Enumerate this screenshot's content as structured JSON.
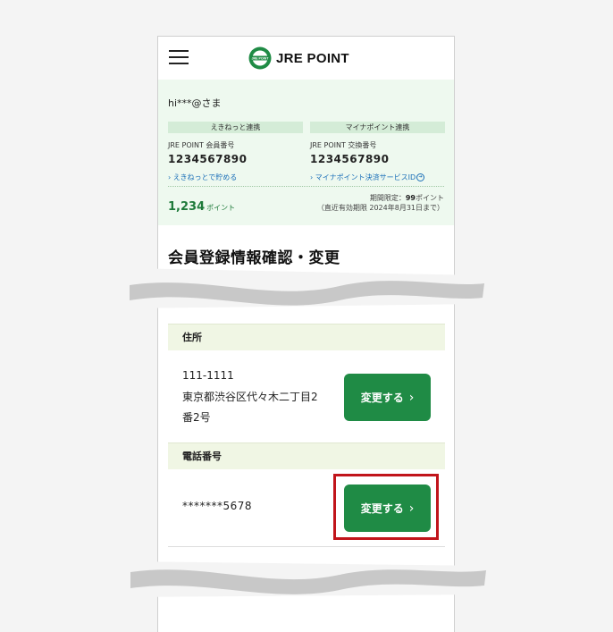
{
  "header": {
    "brand": "JRE POINT",
    "logo_mark_text": "JRE POINT"
  },
  "summary": {
    "greeting": "hi***@さま",
    "left": {
      "tag": "えきねっと連携",
      "label": "JRE POINT 会員番号",
      "number": "1234567890",
      "link": "えきねっとで貯める"
    },
    "right": {
      "tag": "マイナポイント連携",
      "label": "JRE POINT 交換番号",
      "number": "1234567890",
      "link": "マイナポイント決済サービスID"
    },
    "points": {
      "value": "1,234",
      "unit": "ポイント"
    },
    "limit": {
      "prefix": "期間限定：",
      "amount": "99",
      "suffix": "ポイント",
      "note": "（直近有効期限 2024年8月31日まで）"
    }
  },
  "page_title": "会員登録情報確認・変更",
  "address_section": {
    "heading": "住所",
    "postal": "111-1111",
    "line1": "東京都渋谷区代々木二丁目2",
    "line2": "番2号",
    "button": "変更する",
    "chevron": "›"
  },
  "phone_section": {
    "heading": "電話番号",
    "value": "*******5678",
    "button": "変更する",
    "chevron": "›"
  },
  "colors": {
    "brand_green": "#1f8b45",
    "summary_bg": "#eef9ef",
    "highlight": "#c1141b"
  }
}
